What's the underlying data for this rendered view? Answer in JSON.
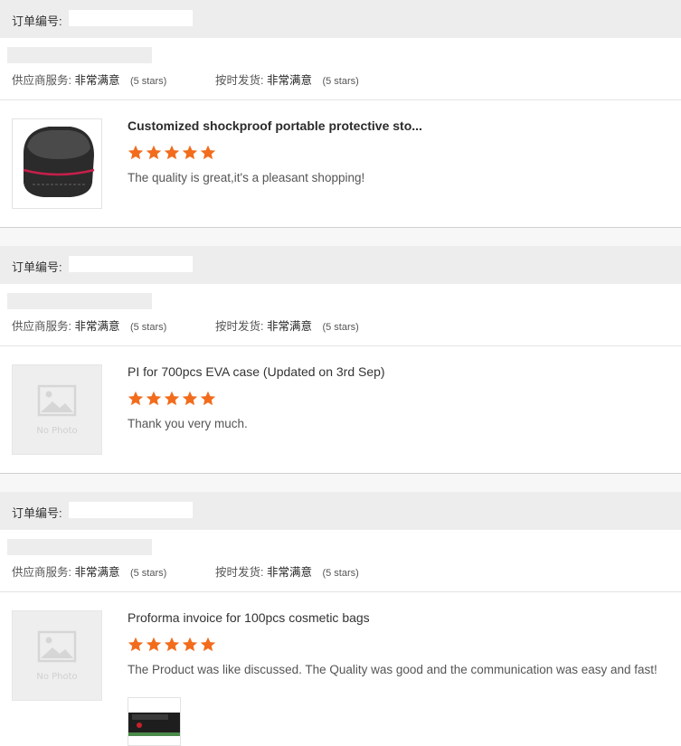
{
  "order_label": "订单编号:",
  "rating_labels": {
    "supplier_service": "供应商服务:",
    "on_time_delivery": "按时发货:",
    "value": "非常满意",
    "stars_text": "(5 stars)"
  },
  "colors": {
    "star": "#f26c1c",
    "header_bg": "#ededed"
  },
  "reviews": [
    {
      "title": "Customized shockproof portable protective sto...",
      "rating": 5,
      "comment": "The quality is great,it's a pleasant shopping!",
      "image": "black-hard-case"
    },
    {
      "title": "PI for 700pcs EVA case (Updated on 3rd Sep)",
      "rating": 5,
      "comment": "Thank you very much.",
      "image": "no-photo",
      "image_text": "No Photo"
    },
    {
      "title": "Proforma invoice for 100pcs cosmetic bags",
      "rating": 5,
      "comment": "The Product was like discussed. The Quality was good and the communication was easy and fast!",
      "image": "no-photo",
      "image_text": "No Photo",
      "attachment": "cosmetic-bag-photo"
    }
  ]
}
